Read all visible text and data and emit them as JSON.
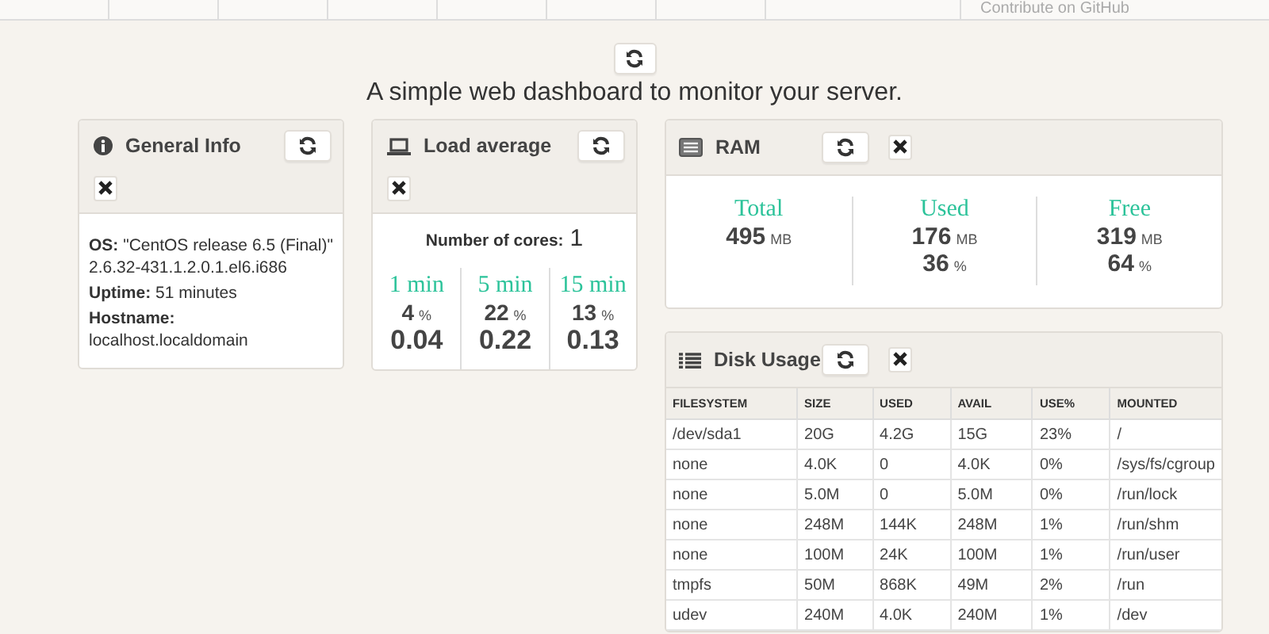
{
  "top_nav": {
    "link": "Contribute on GitHub"
  },
  "tagline": "A simple web dashboard to monitor your server.",
  "general_info": {
    "title": "General Info",
    "fields": [
      {
        "label": "OS:",
        "value": "\"CentOS release 6.5 (Final)\" 2.6.32-431.1.2.0.1.el6.i686"
      },
      {
        "label": "Uptime:",
        "value": "51 minutes"
      },
      {
        "label": "Hostname:",
        "value": "localhost.localdomain"
      }
    ]
  },
  "load_average": {
    "title": "Load average",
    "cores_label": "Number of cores:",
    "cores": "1",
    "periods": [
      {
        "label": "1 min",
        "percent": "4",
        "percent_unit": "%",
        "load": "0.04"
      },
      {
        "label": "5 min",
        "percent": "22",
        "percent_unit": "%",
        "load": "0.22"
      },
      {
        "label": "15 min",
        "percent": "13",
        "percent_unit": "%",
        "load": "0.13"
      }
    ]
  },
  "ram": {
    "title": "RAM",
    "stats": [
      {
        "label": "Total",
        "value": "495",
        "unit": "MB"
      },
      {
        "label": "Used",
        "value": "176",
        "unit": "MB",
        "percent": "36",
        "percent_unit": "%"
      },
      {
        "label": "Free",
        "value": "319",
        "unit": "MB",
        "percent": "64",
        "percent_unit": "%"
      }
    ]
  },
  "disk_usage": {
    "title": "Disk Usage",
    "columns": [
      "FILESYSTEM",
      "SIZE",
      "USED",
      "AVAIL",
      "USE%",
      "MOUNTED"
    ],
    "rows": [
      [
        "/dev/sda1",
        "20G",
        "4.2G",
        "15G",
        "23%",
        "/"
      ],
      [
        "none",
        "4.0K",
        "0",
        "4.0K",
        "0%",
        "/sys/fs/cgroup"
      ],
      [
        "none",
        "5.0M",
        "0",
        "5.0M",
        "0%",
        "/run/lock"
      ],
      [
        "none",
        "248M",
        "144K",
        "248M",
        "1%",
        "/run/shm"
      ],
      [
        "none",
        "100M",
        "24K",
        "100M",
        "1%",
        "/run/user"
      ],
      [
        "tmpfs",
        "50M",
        "868K",
        "49M",
        "2%",
        "/run"
      ],
      [
        "udev",
        "240M",
        "4.0K",
        "240M",
        "1%",
        "/dev"
      ]
    ]
  }
}
